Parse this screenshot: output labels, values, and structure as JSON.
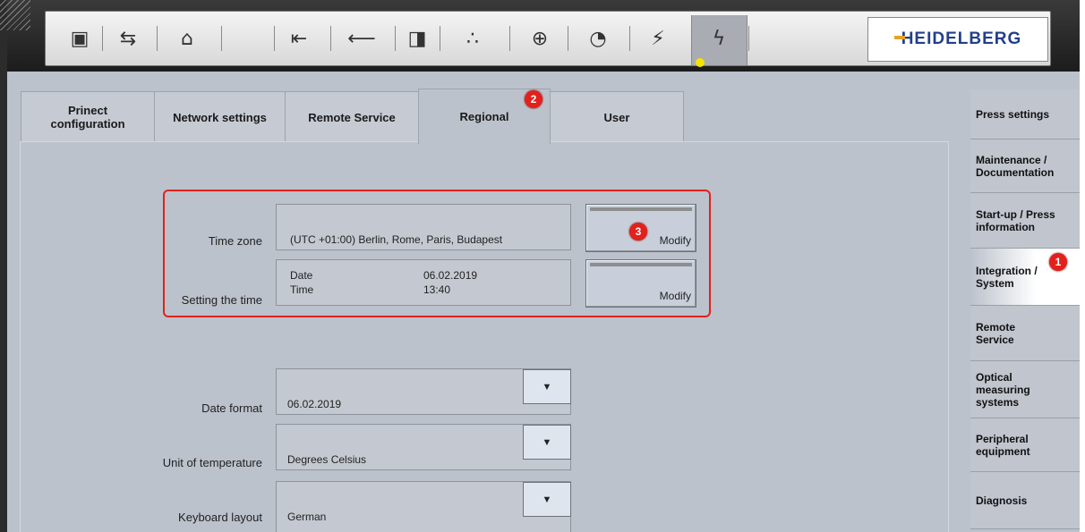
{
  "toolbar": {
    "icons": [
      "calculator-icon",
      "counter-icon",
      "scroll-icon",
      "infeed-icon",
      "arrow-left-icon",
      "pile-icon",
      "dampening-icon",
      "register-icon",
      "measurement-icon",
      "spray-icon",
      "power-icon"
    ],
    "glyphs": [
      "▣",
      "⇆",
      "⌂",
      "⇤",
      "⟵",
      "◨",
      "∴",
      "⊕",
      "◔",
      "⚡",
      "ϟ"
    ],
    "logo": "HEIDELBERG"
  },
  "tabs": [
    {
      "label": "Prinect configuration",
      "active": false
    },
    {
      "label": "Network settings",
      "active": false
    },
    {
      "label": "Remote Service",
      "active": false
    },
    {
      "label": "Regional",
      "active": true
    },
    {
      "label": "User",
      "active": false
    }
  ],
  "badges": {
    "one": "1",
    "two": "2",
    "three": "3"
  },
  "regional": {
    "time_zone_label": "Time zone",
    "time_zone_value": "(UTC +01:00) Berlin, Rome, Paris, Budapest",
    "setting_time_label": "Setting the time",
    "date_label": "Date",
    "date_value": "06.02.2019",
    "time_label": "Time",
    "time_value": "13:40",
    "modify_label": "Modify",
    "date_format_label": "Date format",
    "date_format_value": "06.02.2019",
    "temperature_label": "Unit of temperature",
    "temperature_value": "Degrees Celsius",
    "keyboard_label": "Keyboard layout",
    "keyboard_value": "German",
    "dropdown_glyph": "▼"
  },
  "sidebar": {
    "items": [
      {
        "label": "Press settings"
      },
      {
        "label": "Maintenance / Documentation"
      },
      {
        "label": "Start-up / Press information"
      },
      {
        "label": "Integration / System",
        "active": true
      },
      {
        "label": "Remote Service"
      },
      {
        "label": "Optical measuring systems"
      },
      {
        "label": "Peripheral equipment"
      },
      {
        "label": "Diagnosis"
      }
    ]
  },
  "colors": {
    "accent_red": "#e2211c",
    "status_dot": "#f5e400",
    "logo_blue": "#233f8a"
  }
}
